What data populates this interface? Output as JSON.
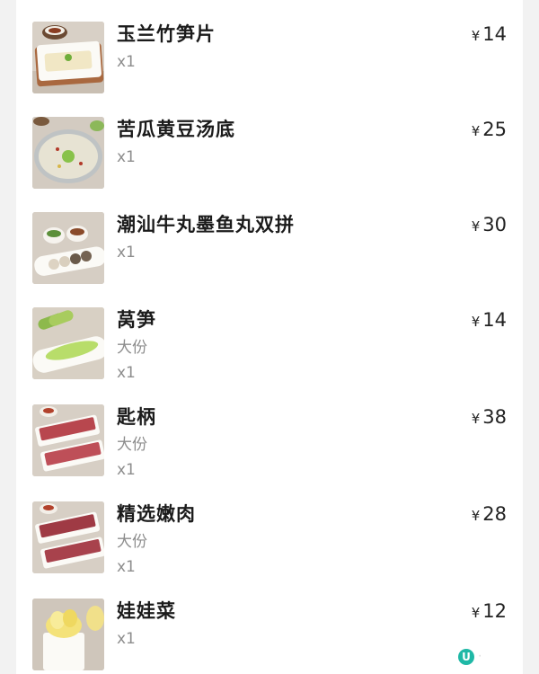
{
  "currency_symbol": "¥",
  "items": [
    {
      "name": "玉兰竹笋片",
      "spec": "",
      "qty": "x1",
      "price": "14",
      "image_icon": "bamboo-shoot-slices-dish"
    },
    {
      "name": "苦瓜黄豆汤底",
      "spec": "",
      "qty": "x1",
      "price": "25",
      "image_icon": "bitter-melon-soy-soup-pot"
    },
    {
      "name": "潮汕牛丸墨鱼丸双拼",
      "spec": "",
      "qty": "x1",
      "price": "30",
      "image_icon": "beef-ball-cuttlefish-ball-platter"
    },
    {
      "name": "莴笋",
      "spec": "大份",
      "qty": "x1",
      "price": "14",
      "image_icon": "lettuce-stem-slices-dish"
    },
    {
      "name": "匙柄",
      "spec": "大份",
      "qty": "x1",
      "price": "38",
      "image_icon": "beef-slices-trays"
    },
    {
      "name": "精选嫩肉",
      "spec": "大份",
      "qty": "x1",
      "price": "28",
      "image_icon": "tender-beef-slices-trays"
    },
    {
      "name": "娃娃菜",
      "spec": "",
      "qty": "x1",
      "price": "12",
      "image_icon": "baby-cabbage-bowl"
    }
  ],
  "watermark": {
    "badge": "U",
    "text": "·"
  }
}
